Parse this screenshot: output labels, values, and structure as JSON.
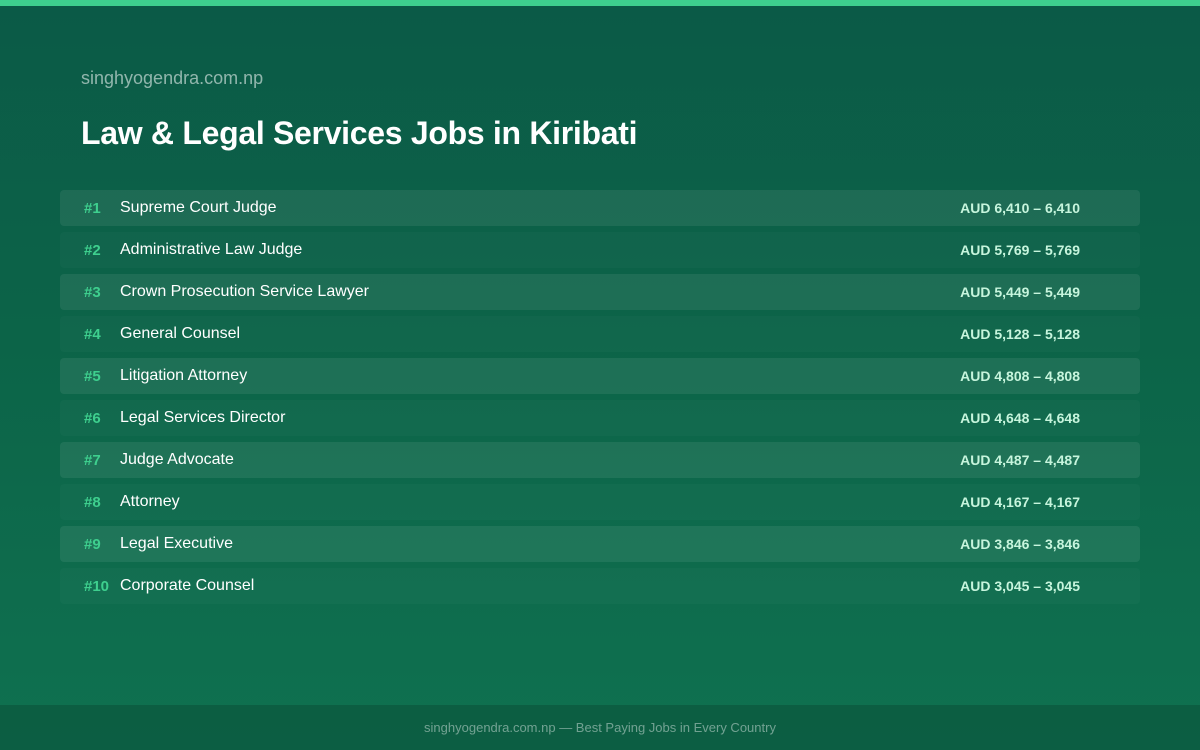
{
  "header": {
    "site": "singhyogendra.com.np",
    "title": "Law & Legal Services Jobs in Kiribati"
  },
  "jobs": [
    {
      "rank": "#1",
      "title": "Supreme Court Judge",
      "salary": "AUD 6,410 – 6,410"
    },
    {
      "rank": "#2",
      "title": "Administrative Law Judge",
      "salary": "AUD 5,769 – 5,769"
    },
    {
      "rank": "#3",
      "title": "Crown Prosecution Service Lawyer",
      "salary": "AUD 5,449 – 5,449"
    },
    {
      "rank": "#4",
      "title": "General Counsel",
      "salary": "AUD 5,128 – 5,128"
    },
    {
      "rank": "#5",
      "title": "Litigation Attorney",
      "salary": "AUD 4,808 – 4,808"
    },
    {
      "rank": "#6",
      "title": "Legal Services Director",
      "salary": "AUD 4,648 – 4,648"
    },
    {
      "rank": "#7",
      "title": "Judge Advocate",
      "salary": "AUD 4,487 – 4,487"
    },
    {
      "rank": "#8",
      "title": "Attorney",
      "salary": "AUD 4,167 – 4,167"
    },
    {
      "rank": "#9",
      "title": "Legal Executive",
      "salary": "AUD 3,846 – 3,846"
    },
    {
      "rank": "#10",
      "title": "Corporate Counsel",
      "salary": "AUD 3,045 – 3,045"
    }
  ],
  "footer": {
    "text": "singhyogendra.com.np — Best Paying Jobs in Every Country"
  },
  "colors": {
    "accent": "#3ecf8e",
    "salary": "#c7f5dd"
  }
}
